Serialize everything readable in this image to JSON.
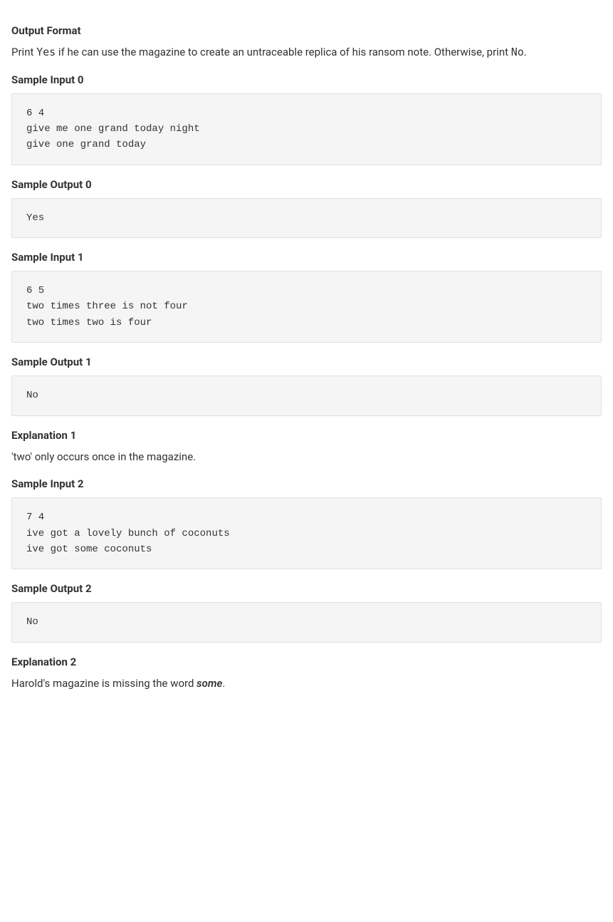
{
  "output_format": {
    "heading": "Output Format",
    "text_before": "Print ",
    "yes_code": "Yes",
    "text_middle": " if he can use the magazine to create an untraceable replica of his ransom note. Otherwise, print ",
    "no_code": "No",
    "text_after": "."
  },
  "sample_input_0": {
    "heading": "Sample Input 0",
    "code": "6 4\ngive me one grand today night\ngive one grand today"
  },
  "sample_output_0": {
    "heading": "Sample Output 0",
    "code": "Yes"
  },
  "sample_input_1": {
    "heading": "Sample Input 1",
    "code": "6 5\ntwo times three is not four\ntwo times two is four"
  },
  "sample_output_1": {
    "heading": "Sample Output 1",
    "code": "No"
  },
  "explanation_1": {
    "heading": "Explanation 1",
    "text": "'two' only occurs once in the magazine."
  },
  "sample_input_2": {
    "heading": "Sample Input 2",
    "code": "7 4\nive got a lovely bunch of coconuts\nive got some coconuts"
  },
  "sample_output_2": {
    "heading": "Sample Output 2",
    "code": "No"
  },
  "explanation_2": {
    "heading": "Explanation 2",
    "text_before": "Harold's magazine is missing the word ",
    "italic_word": "some",
    "text_after": "."
  }
}
